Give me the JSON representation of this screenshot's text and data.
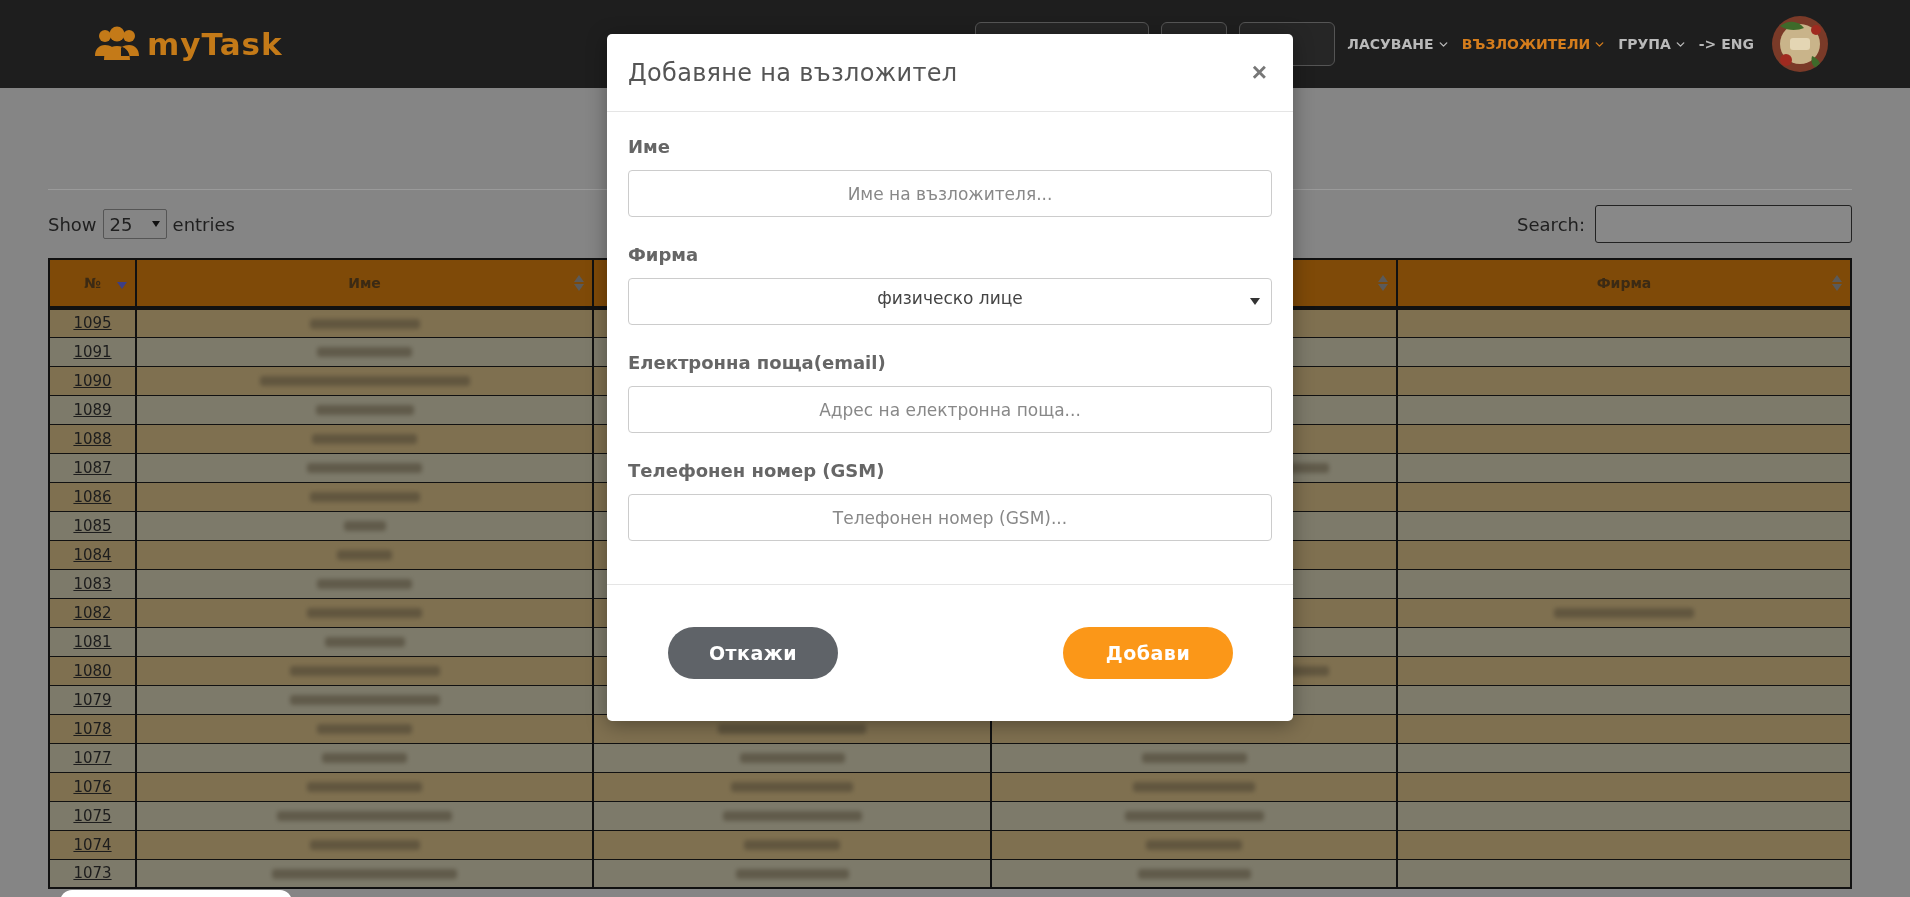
{
  "navbar": {
    "logo": "myTask",
    "menu": [
      {
        "label": "ЛАСУВАНЕ",
        "selected": false,
        "dropdown": true
      },
      {
        "label": "ВЪЗЛОЖИТЕЛИ",
        "selected": true,
        "dropdown": true
      },
      {
        "label": "ГРУПА",
        "selected": false,
        "dropdown": true
      },
      {
        "label": "-> ENG",
        "selected": false,
        "dropdown": false
      }
    ]
  },
  "controls": {
    "show_label": "Show",
    "page_size": "25",
    "entries_label": "entries",
    "search_label": "Search:"
  },
  "table": {
    "columns": [
      {
        "label": "№",
        "sorted": true
      },
      {
        "label": "Име",
        "sorted": false
      },
      {
        "sorted": false
      },
      {
        "label": "Фирма",
        "sorted": false
      }
    ],
    "rows": [
      {
        "number": "1095",
        "blurred": {
          "name": true,
          "phone": false,
          "email": false,
          "company": false
        }
      },
      {
        "number": "1091",
        "blurred": {
          "name": true,
          "phone": false,
          "email": false,
          "company": false
        }
      },
      {
        "number": "1090",
        "blurred": {
          "name": true,
          "phone": false,
          "email": false,
          "company": false
        }
      },
      {
        "number": "1089",
        "blurred": {
          "name": true,
          "phone": false,
          "email": false,
          "company": false
        }
      },
      {
        "number": "1088",
        "blurred": {
          "name": true,
          "phone": false,
          "email": false,
          "company": false
        }
      },
      {
        "number": "1087",
        "blurred": {
          "name": true,
          "phone": false,
          "email": true,
          "company": false
        }
      },
      {
        "number": "1086",
        "blurred": {
          "name": true,
          "phone": false,
          "email": false,
          "company": false
        }
      },
      {
        "number": "1085",
        "blurred": {
          "name": true,
          "phone": false,
          "email": false,
          "company": false
        }
      },
      {
        "number": "1084",
        "blurred": {
          "name": true,
          "phone": false,
          "email": false,
          "company": false
        }
      },
      {
        "number": "1083",
        "blurred": {
          "name": true,
          "phone": false,
          "email": false,
          "company": false
        }
      },
      {
        "number": "1082",
        "blurred": {
          "name": true,
          "phone": false,
          "email": false,
          "company": true
        }
      },
      {
        "number": "1081",
        "blurred": {
          "name": true,
          "phone": false,
          "email": false,
          "company": false
        }
      },
      {
        "number": "1080",
        "blurred": {
          "name": true,
          "phone": false,
          "email": true,
          "company": false
        }
      },
      {
        "number": "1079",
        "blurred": {
          "name": true,
          "phone": false,
          "email": false,
          "company": false
        }
      },
      {
        "number": "1078",
        "blurred": {
          "name": true,
          "phone": true,
          "email": false,
          "company": false
        }
      },
      {
        "number": "1077",
        "blurred": {
          "name": true,
          "phone": true,
          "email": true,
          "company": false
        }
      },
      {
        "number": "1076",
        "blurred": {
          "name": true,
          "phone": true,
          "email": true,
          "company": false
        }
      },
      {
        "number": "1075",
        "blurred": {
          "name": true,
          "phone": true,
          "email": true,
          "company": false
        }
      },
      {
        "number": "1074",
        "blurred": {
          "name": true,
          "phone": true,
          "email": true,
          "company": false
        }
      },
      {
        "number": "1073",
        "blurred": {
          "name": true,
          "phone": true,
          "email": true,
          "company": false
        }
      }
    ]
  },
  "modal": {
    "title": "Добавяне на възложител",
    "close": "×",
    "fields": [
      {
        "kind": "input",
        "label": "Име",
        "placeholder": "Име на възложителя..."
      },
      {
        "kind": "select",
        "label": "Фирма",
        "value": "физическо лице"
      },
      {
        "kind": "input",
        "label": "Електронна поща(email)",
        "placeholder": "Адрес на електронна поща..."
      },
      {
        "kind": "input",
        "label": "Телефонен номер (GSM)",
        "placeholder": "Телефонен номер (GSM)..."
      }
    ],
    "buttons": [
      {
        "kind": "secondary",
        "label": "Откажи"
      },
      {
        "kind": "primary",
        "label": "Добави"
      }
    ]
  }
}
